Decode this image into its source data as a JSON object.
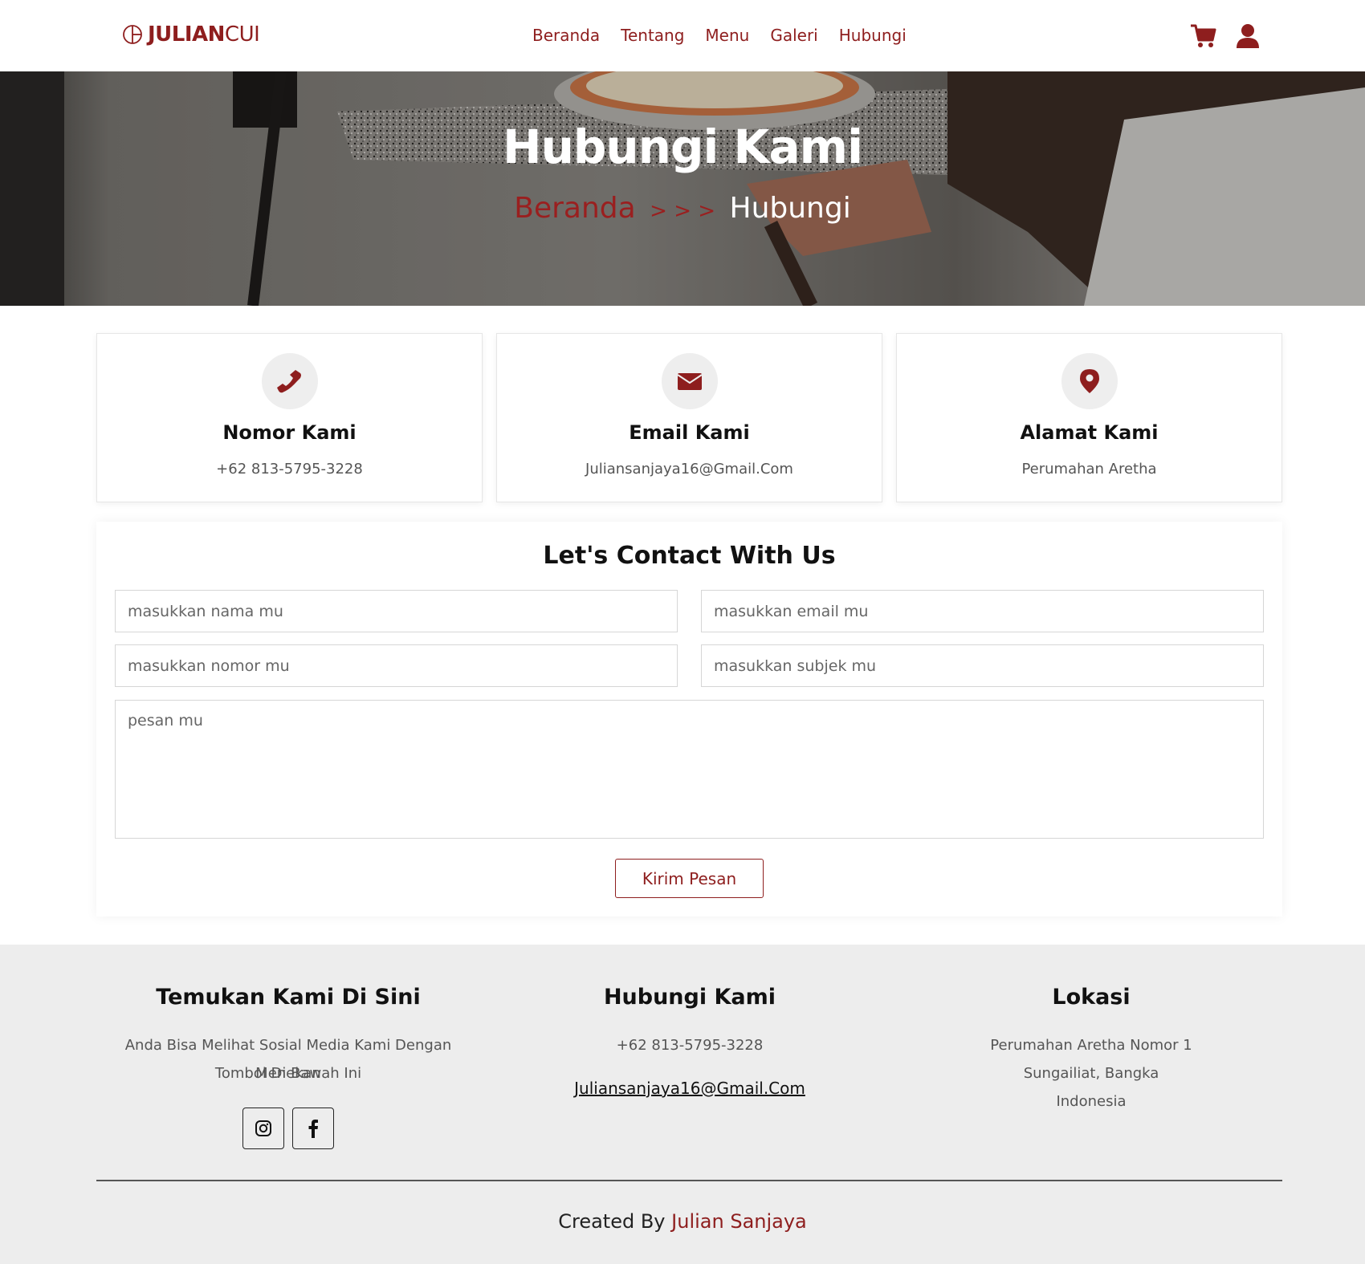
{
  "navbar": {
    "brand_bold": "JULIAN",
    "brand_light": "CUI",
    "links": [
      "Beranda",
      "Tentang",
      "Menu",
      "Galeri",
      "Hubungi"
    ],
    "icons": [
      "cart-icon",
      "user-icon"
    ]
  },
  "hero": {
    "title": "Hubungi Kami",
    "crumb_home": "Beranda",
    "crumb_separator": "> > >",
    "crumb_current": "Hubungi"
  },
  "cards": [
    {
      "icon": "phone-icon",
      "title": "Nomor Kami",
      "value": "+62 813-5795-3228"
    },
    {
      "icon": "envelope-icon",
      "title": "Email Kami",
      "value": "Juliansanjaya16@Gmail.Com"
    },
    {
      "icon": "map-pin-icon",
      "title": "Alamat Kami",
      "value": "Perumahan Aretha"
    }
  ],
  "form": {
    "title": "Let's Contact With Us",
    "name_placeholder": "masukkan nama mu",
    "email_placeholder": "masukkan email mu",
    "phone_placeholder": "masukkan nomor mu",
    "subject_placeholder": "masukkan subjek mu",
    "message_placeholder": "pesan mu",
    "submit_label": "Kirim Pesan"
  },
  "footer": {
    "social": {
      "title": "Temukan Kami Di Sini",
      "text_line1": "Anda Bisa Melihat Sosial Media Kami Dengan Menekan",
      "text_line2": "Tombol Di Bawah Ini",
      "icons": [
        "instagram-icon",
        "facebook-icon"
      ]
    },
    "contact": {
      "title": "Hubungi Kami",
      "phone": "+62 813-5795-3228",
      "email": "Juliansanjaya16@Gmail.Com"
    },
    "location": {
      "title": "Lokasi",
      "line1": "Perumahan Aretha Nomor 1",
      "line2": "Sungailiat, Bangka",
      "line3": "Indonesia"
    },
    "credit_prefix": "Created By",
    "credit_name": "Julian Sanjaya"
  },
  "colors": {
    "brand": "#8e1e1e",
    "footer_bg": "#ededed",
    "icon_circle": "#eeeeee"
  }
}
